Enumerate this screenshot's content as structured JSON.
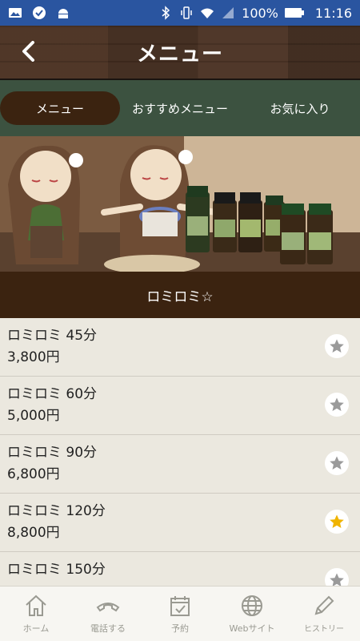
{
  "status_bar": {
    "battery": "100%",
    "time": "11:16"
  },
  "header": {
    "title": "メニュー"
  },
  "tabs": [
    {
      "label": "メニュー",
      "active": true
    },
    {
      "label": "おすすめメニュー",
      "active": false
    },
    {
      "label": "お気に入り",
      "active": false
    }
  ],
  "section": {
    "title": "ロミロミ☆"
  },
  "items": [
    {
      "name": "ロミロミ 45分",
      "price": "3,800円",
      "favorite": false
    },
    {
      "name": "ロミロミ 60分",
      "price": "5,000円",
      "favorite": false
    },
    {
      "name": "ロミロミ 90分",
      "price": "6,800円",
      "favorite": false
    },
    {
      "name": "ロミロミ 120分",
      "price": "8,800円",
      "favorite": true
    },
    {
      "name": "ロミロミ 150分",
      "price": "",
      "favorite": false
    }
  ],
  "nav": [
    {
      "label": "ホーム",
      "icon": "home-icon"
    },
    {
      "label": "電話する",
      "icon": "phone-icon"
    },
    {
      "label": "予約",
      "icon": "calendar-check-icon"
    },
    {
      "label": "Webサイト",
      "icon": "globe-icon"
    },
    {
      "label": "ヒストリー",
      "icon": "pencil-icon"
    }
  ],
  "colors": {
    "accent": "#3b2310",
    "tab_bar": "#3c5240",
    "star_active": "#f0b400",
    "star_inactive": "#9a9a9a"
  }
}
